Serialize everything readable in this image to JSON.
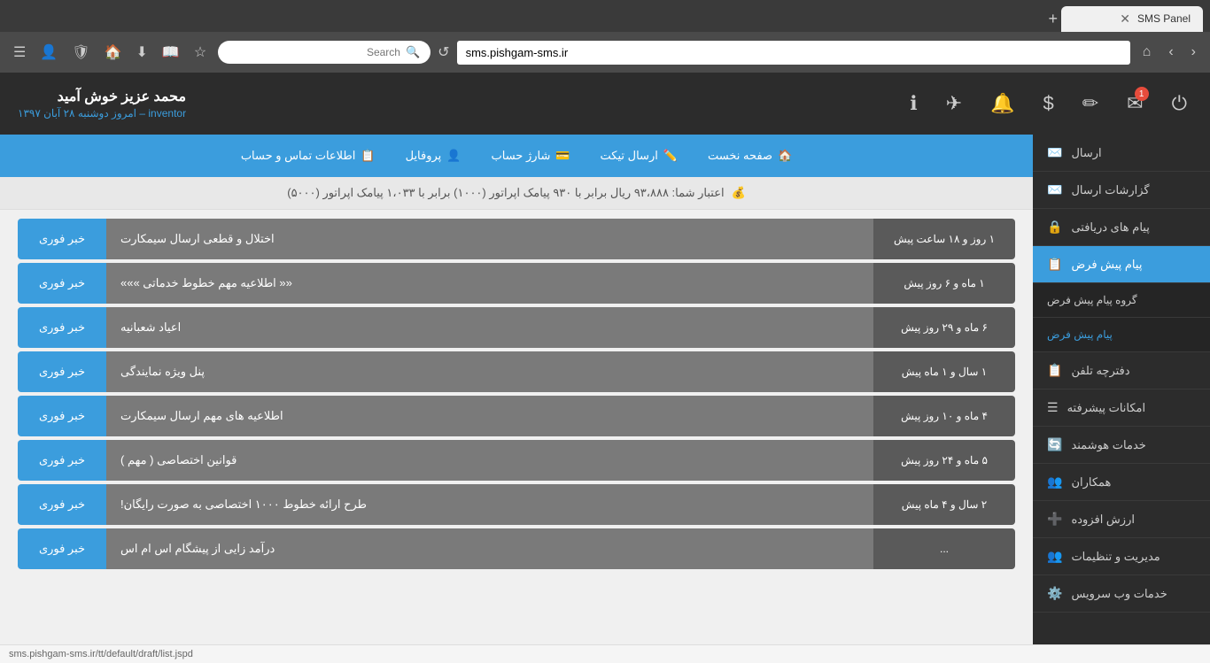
{
  "browser": {
    "tab_title": "SMS Panel",
    "address": "sms.pishgam-sms.ir",
    "search_placeholder": "Search",
    "new_tab_label": "+"
  },
  "header": {
    "username": "محمد عزیز خوش آمید",
    "role": "inventor",
    "date_label": "امروز دوشنبه ۲۸ آبان ۱۳۹۷",
    "separator": "–",
    "badge_count": "1"
  },
  "navbar": {
    "items": [
      {
        "label": "صفحه نخست",
        "icon": "🏠"
      },
      {
        "label": "ارسال تیکت",
        "icon": "✏️"
      },
      {
        "label": "شارژ حساب",
        "icon": "💳"
      },
      {
        "label": "پروفایل",
        "icon": "👤"
      },
      {
        "label": "اطلاعات تماس و حساب",
        "icon": "📋"
      }
    ]
  },
  "credit_bar": {
    "text": "اعتبار شما: ۹۳،۸۸۸ ریال برابر با ۹۳۰ پیامک اپراتور (۱۰۰۰) برابر با ۱،۰۳۳ پیامک اپراتور (۵۰۰۰)",
    "icon": "💰"
  },
  "messages": [
    {
      "tag": "خبر فوری",
      "title": "اختلال و قطعی ارسال سیمکارت",
      "time": "۱ روز و ۱۸ ساعت پیش"
    },
    {
      "tag": "خبر فوری",
      "title": "«« اطلاعیه مهم خطوط خدماتی »»»",
      "time": "۱ ماه و ۶ روز پیش"
    },
    {
      "tag": "خبر فوری",
      "title": "اعیاد شعبانیه",
      "time": "۶ ماه و ۲۹ روز پیش"
    },
    {
      "tag": "خبر فوری",
      "title": "پنل ویژه نمایندگی",
      "time": "۱ سال و ۱ ماه پیش"
    },
    {
      "tag": "خبر فوری",
      "title": "اطلاعیه های مهم ارسال سیمکارت",
      "time": "۴ ماه و ۱۰ روز پیش"
    },
    {
      "tag": "خبر فوری",
      "title": "قوانین اختصاصی ( مهم )",
      "time": "۵ ماه و ۲۴ روز پیش"
    },
    {
      "tag": "خبر فوری",
      "title": "طرح ارائه خطوط ۱۰۰۰ اختصاصی به صورت رایگان!",
      "time": "۲ سال و ۴ ماه پیش"
    },
    {
      "tag": "خبر فوری",
      "title": "درآمد زایی از پیشگام اس ام اس",
      "time": "..."
    }
  ],
  "sidebar": {
    "items": [
      {
        "label": "ارسال",
        "icon": "✉️",
        "active": false
      },
      {
        "label": "گزارشات ارسال",
        "icon": "✉️",
        "active": false
      },
      {
        "label": "پیام های دریافتی",
        "icon": "🔒",
        "active": false
      },
      {
        "label": "پیام پیش فرض",
        "icon": "📋",
        "active": true
      },
      {
        "label": "گروه پیام پیش فرض",
        "icon": "",
        "active": false,
        "sub": true
      },
      {
        "label": "پیام پیش فرض",
        "icon": "",
        "active": false,
        "sub": true,
        "sub_active": true
      },
      {
        "label": "دفترچه تلفن",
        "icon": "📋",
        "active": false
      },
      {
        "label": "امکانات پیشرفته",
        "icon": "☰",
        "active": false
      },
      {
        "label": "خدمات هوشمند",
        "icon": "🔄",
        "active": false
      },
      {
        "label": "همکاران",
        "icon": "👥",
        "active": false
      },
      {
        "label": "ارزش افزوده",
        "icon": "➕",
        "active": false
      },
      {
        "label": "مدیریت و تنظیمات",
        "icon": "👥",
        "active": false
      },
      {
        "label": "خدمات وب سرویس",
        "icon": "⚙️",
        "active": false
      }
    ]
  },
  "status_bar": {
    "url": "sms.pishgam-sms.ir/tt/default/draft/list.jspd"
  }
}
